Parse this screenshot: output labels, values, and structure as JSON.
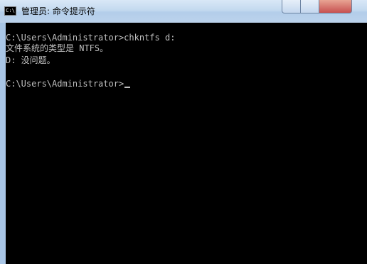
{
  "window": {
    "title": "管理员: 命令提示符",
    "icon": "cmd-icon",
    "icon_text": "C:\\"
  },
  "console": {
    "lines": [
      "C:\\Users\\Administrator>chkntfs d:",
      "文件系统的类型是 NTFS。",
      "D: 没问题。",
      "",
      "C:\\Users\\Administrator>"
    ],
    "text_color": "#c0c0c0",
    "background": "#000000"
  },
  "colors": {
    "titlebar": "#c3d9ef",
    "frame": "#a9c6e6"
  }
}
